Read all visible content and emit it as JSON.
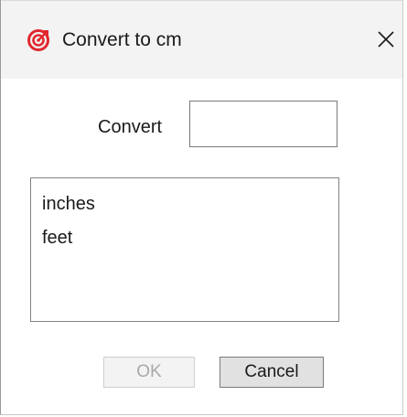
{
  "window": {
    "title": "Convert to cm",
    "close_symbol": "✕",
    "icon": "target-icon",
    "accent_color": "#e0282e"
  },
  "form": {
    "convert_label": "Convert",
    "convert_value": "",
    "convert_placeholder": ""
  },
  "units_list": {
    "items": [
      {
        "label": "inches"
      },
      {
        "label": "feet"
      }
    ]
  },
  "buttons": {
    "ok_label": "OK",
    "ok_enabled": false,
    "cancel_label": "Cancel"
  }
}
